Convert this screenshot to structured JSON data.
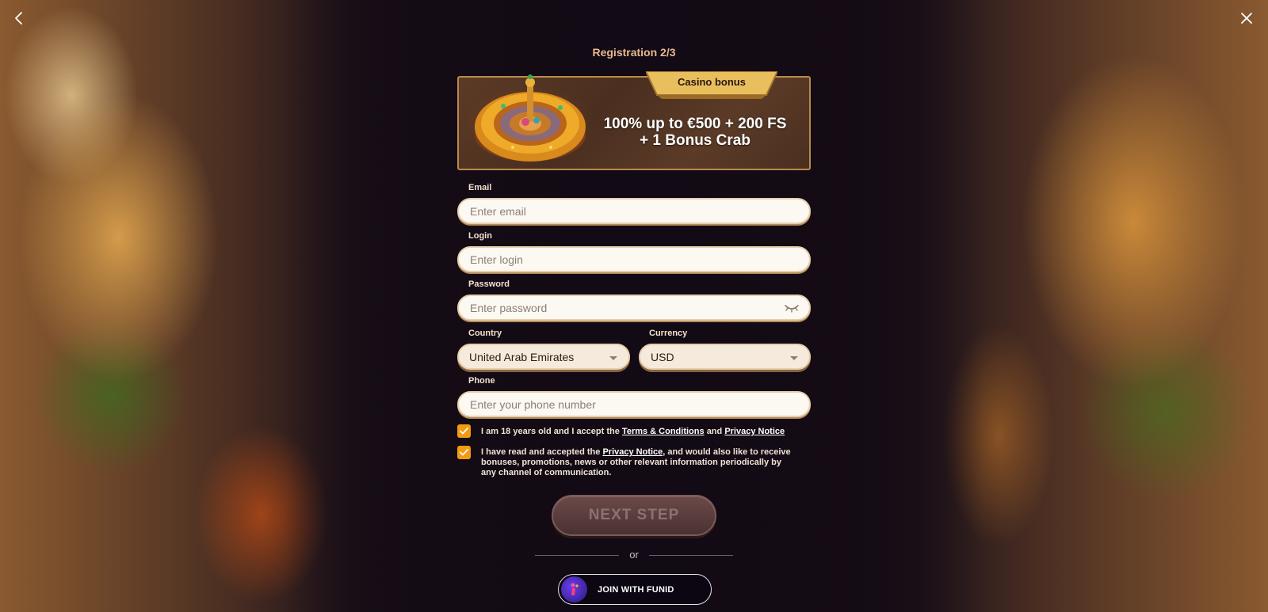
{
  "header": {
    "back_icon": "chevron-left-icon",
    "close_icon": "close-icon",
    "step_title": "Registration 2/3"
  },
  "banner": {
    "tag": "Casino bonus",
    "line1": "100% up to €500 + 200 FS",
    "line2": "+ 1 Bonus Crab",
    "image": "roulette-wheel-image"
  },
  "form": {
    "email": {
      "label": "Email",
      "placeholder": "Enter email",
      "value": ""
    },
    "login": {
      "label": "Login",
      "placeholder": "Enter login",
      "value": ""
    },
    "password": {
      "label": "Password",
      "placeholder": "Enter password",
      "value": "",
      "toggle_icon": "eye-closed-icon"
    },
    "country": {
      "label": "Country",
      "value": "United Arab Emirates"
    },
    "currency": {
      "label": "Currency",
      "value": "USD"
    },
    "phone": {
      "label": "Phone",
      "placeholder": "Enter your phone number",
      "value": ""
    }
  },
  "consents": {
    "age": {
      "checked": true,
      "prefix": "I am 18 years old and I accept the",
      "terms_link": "Terms & Conditions",
      "and": "and",
      "privacy_link": "Privacy Notice"
    },
    "marketing": {
      "checked": true,
      "prefix": "I have read and accepted the",
      "privacy_link": "Privacy Notice",
      "suffix": ", and would also like to receive bonuses, promotions, news or other relevant information periodically by any channel of communication."
    }
  },
  "actions": {
    "next_label": "NEXT STEP",
    "or_label": "or",
    "funid_label": "JOIN WITH FUNID"
  },
  "colors": {
    "accent_orange": "#f39a12",
    "title_gold": "#e8b98f",
    "ribbon_gold": "#e9bf5e",
    "button_disabled": "#4a3232"
  }
}
